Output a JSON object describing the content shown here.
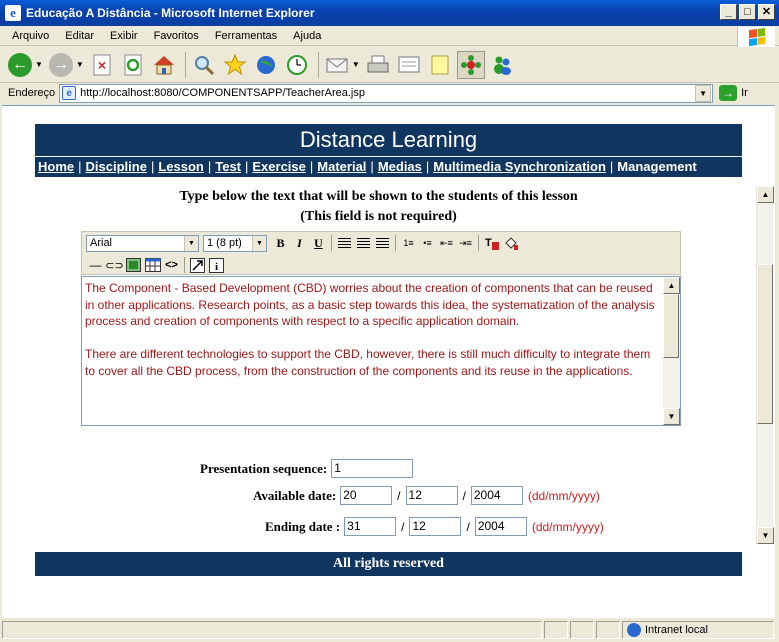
{
  "window": {
    "title": "Educação A Distância - Microsoft Internet Explorer",
    "buttons": {
      "minimize": "_",
      "maximize": "□",
      "close": "✕"
    }
  },
  "menu": [
    "Arquivo",
    "Editar",
    "Exibir",
    "Favoritos",
    "Ferramentas",
    "Ajuda"
  ],
  "address": {
    "label": "Endereço",
    "url": "http://localhost:8080/COMPONENTSAPP/TeacherArea.jsp",
    "go_label": "Ir"
  },
  "page": {
    "banner": "Distance Learning",
    "nav": [
      {
        "label": "Home",
        "link": true
      },
      {
        "label": "Discipline",
        "link": true
      },
      {
        "label": "Lesson",
        "link": true
      },
      {
        "label": "Test",
        "link": true
      },
      {
        "label": "Exercise",
        "link": true
      },
      {
        "label": "Material",
        "link": true
      },
      {
        "label": "Medias",
        "link": true
      },
      {
        "label": "Multimedia Synchronization",
        "link": true
      },
      {
        "label": "Management",
        "link": false
      }
    ],
    "instruction_line1": "Type below the text that will be shown to the students of this lesson",
    "instruction_line2": "(This field is not required)",
    "editor": {
      "font_family": "Arial",
      "font_size": "1 (8 pt)",
      "paragraph1": "The Component - Based Development (CBD) worries about the creation of components that can be reused in other applications.  Research points, as a basic step towards this idea, the systematization of the analysis process and creation of components with respect to a specific application domain.",
      "paragraph2": "There are different technologies to support the CBD, however, there is still much difficulty to integrate them to cover all the CBD process, from the construction of the components and its reuse in the applications."
    },
    "form": {
      "presentation_label": "Presentation sequence:",
      "presentation_value": "1",
      "available_label": "Available date:",
      "available_day": "20",
      "available_month": "12",
      "available_year": "2004",
      "ending_label": "Ending date :",
      "ending_day": "31",
      "ending_month": "12",
      "ending_year": "2004",
      "date_hint": "(dd/mm/yyyy)"
    },
    "footer": "All rights reserved"
  },
  "status": {
    "zone": "Intranet local"
  }
}
